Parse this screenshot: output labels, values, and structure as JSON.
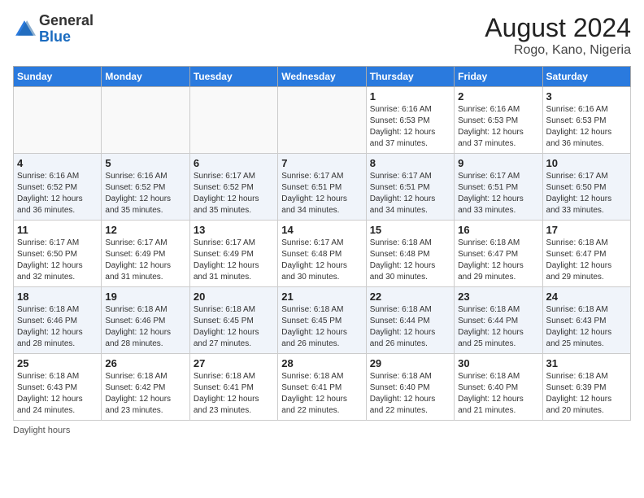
{
  "header": {
    "logo_general": "General",
    "logo_blue": "Blue",
    "month_year": "August 2024",
    "location": "Rogo, Kano, Nigeria"
  },
  "footer": {
    "label": "Daylight hours"
  },
  "days_of_week": [
    "Sunday",
    "Monday",
    "Tuesday",
    "Wednesday",
    "Thursday",
    "Friday",
    "Saturday"
  ],
  "weeks": [
    [
      {
        "day": "",
        "empty": true
      },
      {
        "day": "",
        "empty": true
      },
      {
        "day": "",
        "empty": true
      },
      {
        "day": "",
        "empty": true
      },
      {
        "day": "1",
        "sunrise": "6:16 AM",
        "sunset": "6:53 PM",
        "daylight": "12 hours and 37 minutes."
      },
      {
        "day": "2",
        "sunrise": "6:16 AM",
        "sunset": "6:53 PM",
        "daylight": "12 hours and 37 minutes."
      },
      {
        "day": "3",
        "sunrise": "6:16 AM",
        "sunset": "6:53 PM",
        "daylight": "12 hours and 36 minutes."
      }
    ],
    [
      {
        "day": "4",
        "sunrise": "6:16 AM",
        "sunset": "6:52 PM",
        "daylight": "12 hours and 36 minutes."
      },
      {
        "day": "5",
        "sunrise": "6:16 AM",
        "sunset": "6:52 PM",
        "daylight": "12 hours and 35 minutes."
      },
      {
        "day": "6",
        "sunrise": "6:17 AM",
        "sunset": "6:52 PM",
        "daylight": "12 hours and 35 minutes."
      },
      {
        "day": "7",
        "sunrise": "6:17 AM",
        "sunset": "6:51 PM",
        "daylight": "12 hours and 34 minutes."
      },
      {
        "day": "8",
        "sunrise": "6:17 AM",
        "sunset": "6:51 PM",
        "daylight": "12 hours and 34 minutes."
      },
      {
        "day": "9",
        "sunrise": "6:17 AM",
        "sunset": "6:51 PM",
        "daylight": "12 hours and 33 minutes."
      },
      {
        "day": "10",
        "sunrise": "6:17 AM",
        "sunset": "6:50 PM",
        "daylight": "12 hours and 33 minutes."
      }
    ],
    [
      {
        "day": "11",
        "sunrise": "6:17 AM",
        "sunset": "6:50 PM",
        "daylight": "12 hours and 32 minutes."
      },
      {
        "day": "12",
        "sunrise": "6:17 AM",
        "sunset": "6:49 PM",
        "daylight": "12 hours and 31 minutes."
      },
      {
        "day": "13",
        "sunrise": "6:17 AM",
        "sunset": "6:49 PM",
        "daylight": "12 hours and 31 minutes."
      },
      {
        "day": "14",
        "sunrise": "6:17 AM",
        "sunset": "6:48 PM",
        "daylight": "12 hours and 30 minutes."
      },
      {
        "day": "15",
        "sunrise": "6:18 AM",
        "sunset": "6:48 PM",
        "daylight": "12 hours and 30 minutes."
      },
      {
        "day": "16",
        "sunrise": "6:18 AM",
        "sunset": "6:47 PM",
        "daylight": "12 hours and 29 minutes."
      },
      {
        "day": "17",
        "sunrise": "6:18 AM",
        "sunset": "6:47 PM",
        "daylight": "12 hours and 29 minutes."
      }
    ],
    [
      {
        "day": "18",
        "sunrise": "6:18 AM",
        "sunset": "6:46 PM",
        "daylight": "12 hours and 28 minutes."
      },
      {
        "day": "19",
        "sunrise": "6:18 AM",
        "sunset": "6:46 PM",
        "daylight": "12 hours and 28 minutes."
      },
      {
        "day": "20",
        "sunrise": "6:18 AM",
        "sunset": "6:45 PM",
        "daylight": "12 hours and 27 minutes."
      },
      {
        "day": "21",
        "sunrise": "6:18 AM",
        "sunset": "6:45 PM",
        "daylight": "12 hours and 26 minutes."
      },
      {
        "day": "22",
        "sunrise": "6:18 AM",
        "sunset": "6:44 PM",
        "daylight": "12 hours and 26 minutes."
      },
      {
        "day": "23",
        "sunrise": "6:18 AM",
        "sunset": "6:44 PM",
        "daylight": "12 hours and 25 minutes."
      },
      {
        "day": "24",
        "sunrise": "6:18 AM",
        "sunset": "6:43 PM",
        "daylight": "12 hours and 25 minutes."
      }
    ],
    [
      {
        "day": "25",
        "sunrise": "6:18 AM",
        "sunset": "6:43 PM",
        "daylight": "12 hours and 24 minutes."
      },
      {
        "day": "26",
        "sunrise": "6:18 AM",
        "sunset": "6:42 PM",
        "daylight": "12 hours and 23 minutes."
      },
      {
        "day": "27",
        "sunrise": "6:18 AM",
        "sunset": "6:41 PM",
        "daylight": "12 hours and 23 minutes."
      },
      {
        "day": "28",
        "sunrise": "6:18 AM",
        "sunset": "6:41 PM",
        "daylight": "12 hours and 22 minutes."
      },
      {
        "day": "29",
        "sunrise": "6:18 AM",
        "sunset": "6:40 PM",
        "daylight": "12 hours and 22 minutes."
      },
      {
        "day": "30",
        "sunrise": "6:18 AM",
        "sunset": "6:40 PM",
        "daylight": "12 hours and 21 minutes."
      },
      {
        "day": "31",
        "sunrise": "6:18 AM",
        "sunset": "6:39 PM",
        "daylight": "12 hours and 20 minutes."
      }
    ]
  ]
}
